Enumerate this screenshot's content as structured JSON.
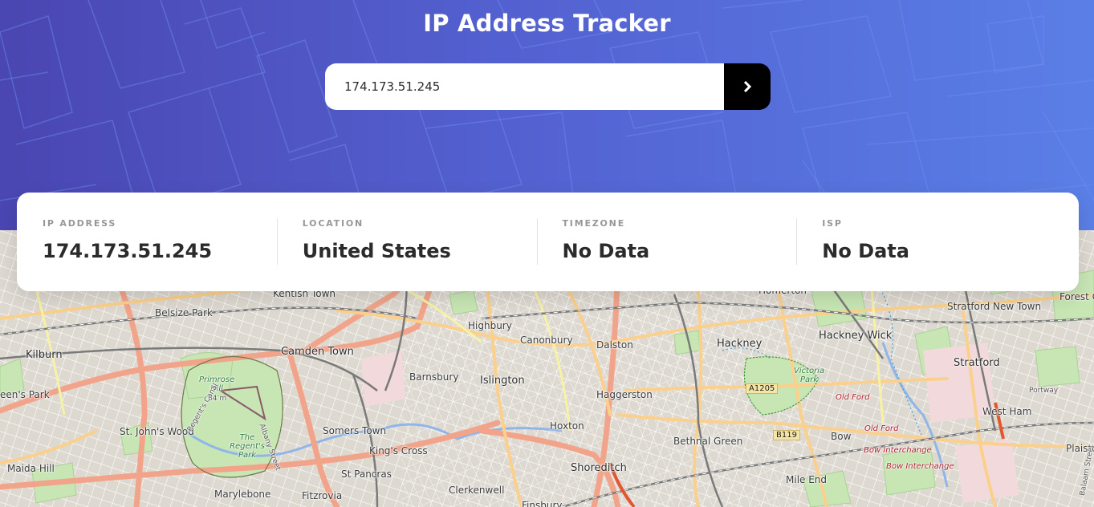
{
  "header": {
    "title": "IP Address Tracker",
    "search": {
      "value": "174.173.51.245",
      "button_icon": "chevron-right-icon"
    }
  },
  "info": {
    "ip": {
      "label": "IP ADDRESS",
      "value": "174.173.51.245"
    },
    "location": {
      "label": "LOCATION",
      "value": "United States"
    },
    "timezone": {
      "label": "TIMEZONE",
      "value": "No Data"
    },
    "isp": {
      "label": "ISP",
      "value": "No Data"
    }
  },
  "map": {
    "places": [
      "Kentish Town",
      "Homerton",
      "Stratford New Town",
      "Forest G",
      "Belsize Park",
      "Highbury",
      "Hackney Wick",
      "Kilburn",
      "Camden Town",
      "Canonbury",
      "Dalston",
      "Hackney",
      "Stratford",
      "een's Park",
      "Barnsbury",
      "Islington",
      "Haggerston",
      "Primrose Hill",
      "Victoria Park",
      "Old Ford",
      "West Ham",
      "St. John's Wood",
      "Somers Town",
      "The Regent's Park",
      "Hoxton",
      "Bethnal Green",
      "Bow",
      "Old Ford",
      "King's Cross",
      "Bow Interchange",
      "Bow Interchange",
      "Plaisto",
      "Maida Hill",
      "St Pancras",
      "Shoreditch",
      "Marylebone",
      "Fitzrovia",
      "Clerkenwell",
      "Finsbury",
      "Mile End",
      "A1205",
      "B119",
      "Portway",
      "64 m",
      "Albany Street",
      "Regent's Canal",
      "Balaam Street"
    ]
  }
}
